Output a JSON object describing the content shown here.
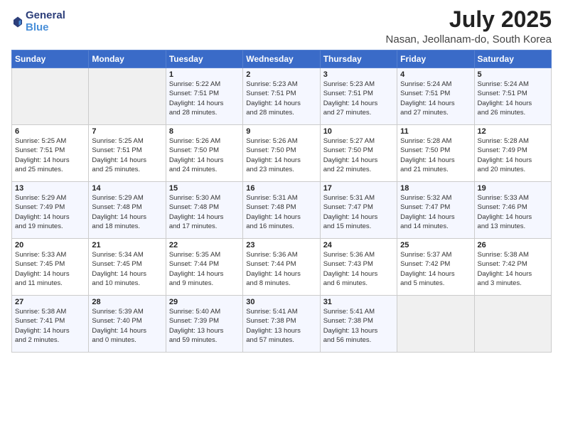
{
  "header": {
    "logo_general": "General",
    "logo_blue": "Blue",
    "month_title": "July 2025",
    "location": "Nasan, Jeollanam-do, South Korea"
  },
  "days_of_week": [
    "Sunday",
    "Monday",
    "Tuesday",
    "Wednesday",
    "Thursday",
    "Friday",
    "Saturday"
  ],
  "weeks": [
    [
      {
        "day": "",
        "content": ""
      },
      {
        "day": "",
        "content": ""
      },
      {
        "day": "1",
        "content": "Sunrise: 5:22 AM\nSunset: 7:51 PM\nDaylight: 14 hours\nand 28 minutes."
      },
      {
        "day": "2",
        "content": "Sunrise: 5:23 AM\nSunset: 7:51 PM\nDaylight: 14 hours\nand 28 minutes."
      },
      {
        "day": "3",
        "content": "Sunrise: 5:23 AM\nSunset: 7:51 PM\nDaylight: 14 hours\nand 27 minutes."
      },
      {
        "day": "4",
        "content": "Sunrise: 5:24 AM\nSunset: 7:51 PM\nDaylight: 14 hours\nand 27 minutes."
      },
      {
        "day": "5",
        "content": "Sunrise: 5:24 AM\nSunset: 7:51 PM\nDaylight: 14 hours\nand 26 minutes."
      }
    ],
    [
      {
        "day": "6",
        "content": "Sunrise: 5:25 AM\nSunset: 7:51 PM\nDaylight: 14 hours\nand 25 minutes."
      },
      {
        "day": "7",
        "content": "Sunrise: 5:25 AM\nSunset: 7:51 PM\nDaylight: 14 hours\nand 25 minutes."
      },
      {
        "day": "8",
        "content": "Sunrise: 5:26 AM\nSunset: 7:50 PM\nDaylight: 14 hours\nand 24 minutes."
      },
      {
        "day": "9",
        "content": "Sunrise: 5:26 AM\nSunset: 7:50 PM\nDaylight: 14 hours\nand 23 minutes."
      },
      {
        "day": "10",
        "content": "Sunrise: 5:27 AM\nSunset: 7:50 PM\nDaylight: 14 hours\nand 22 minutes."
      },
      {
        "day": "11",
        "content": "Sunrise: 5:28 AM\nSunset: 7:50 PM\nDaylight: 14 hours\nand 21 minutes."
      },
      {
        "day": "12",
        "content": "Sunrise: 5:28 AM\nSunset: 7:49 PM\nDaylight: 14 hours\nand 20 minutes."
      }
    ],
    [
      {
        "day": "13",
        "content": "Sunrise: 5:29 AM\nSunset: 7:49 PM\nDaylight: 14 hours\nand 19 minutes."
      },
      {
        "day": "14",
        "content": "Sunrise: 5:29 AM\nSunset: 7:48 PM\nDaylight: 14 hours\nand 18 minutes."
      },
      {
        "day": "15",
        "content": "Sunrise: 5:30 AM\nSunset: 7:48 PM\nDaylight: 14 hours\nand 17 minutes."
      },
      {
        "day": "16",
        "content": "Sunrise: 5:31 AM\nSunset: 7:48 PM\nDaylight: 14 hours\nand 16 minutes."
      },
      {
        "day": "17",
        "content": "Sunrise: 5:31 AM\nSunset: 7:47 PM\nDaylight: 14 hours\nand 15 minutes."
      },
      {
        "day": "18",
        "content": "Sunrise: 5:32 AM\nSunset: 7:47 PM\nDaylight: 14 hours\nand 14 minutes."
      },
      {
        "day": "19",
        "content": "Sunrise: 5:33 AM\nSunset: 7:46 PM\nDaylight: 14 hours\nand 13 minutes."
      }
    ],
    [
      {
        "day": "20",
        "content": "Sunrise: 5:33 AM\nSunset: 7:45 PM\nDaylight: 14 hours\nand 11 minutes."
      },
      {
        "day": "21",
        "content": "Sunrise: 5:34 AM\nSunset: 7:45 PM\nDaylight: 14 hours\nand 10 minutes."
      },
      {
        "day": "22",
        "content": "Sunrise: 5:35 AM\nSunset: 7:44 PM\nDaylight: 14 hours\nand 9 minutes."
      },
      {
        "day": "23",
        "content": "Sunrise: 5:36 AM\nSunset: 7:44 PM\nDaylight: 14 hours\nand 8 minutes."
      },
      {
        "day": "24",
        "content": "Sunrise: 5:36 AM\nSunset: 7:43 PM\nDaylight: 14 hours\nand 6 minutes."
      },
      {
        "day": "25",
        "content": "Sunrise: 5:37 AM\nSunset: 7:42 PM\nDaylight: 14 hours\nand 5 minutes."
      },
      {
        "day": "26",
        "content": "Sunrise: 5:38 AM\nSunset: 7:42 PM\nDaylight: 14 hours\nand 3 minutes."
      }
    ],
    [
      {
        "day": "27",
        "content": "Sunrise: 5:38 AM\nSunset: 7:41 PM\nDaylight: 14 hours\nand 2 minutes."
      },
      {
        "day": "28",
        "content": "Sunrise: 5:39 AM\nSunset: 7:40 PM\nDaylight: 14 hours\nand 0 minutes."
      },
      {
        "day": "29",
        "content": "Sunrise: 5:40 AM\nSunset: 7:39 PM\nDaylight: 13 hours\nand 59 minutes."
      },
      {
        "day": "30",
        "content": "Sunrise: 5:41 AM\nSunset: 7:38 PM\nDaylight: 13 hours\nand 57 minutes."
      },
      {
        "day": "31",
        "content": "Sunrise: 5:41 AM\nSunset: 7:38 PM\nDaylight: 13 hours\nand 56 minutes."
      },
      {
        "day": "",
        "content": ""
      },
      {
        "day": "",
        "content": ""
      }
    ]
  ]
}
